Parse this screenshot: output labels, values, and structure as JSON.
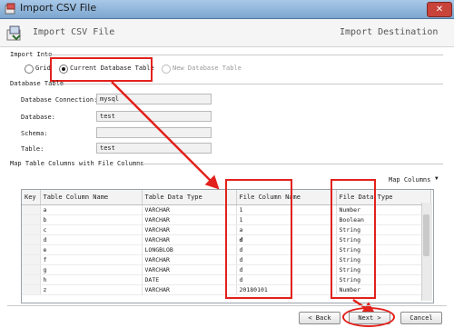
{
  "window": {
    "title": "Import CSV File"
  },
  "header": {
    "title": "Import CSV File",
    "right": "Import Destination"
  },
  "import_into": {
    "label": "Import Into",
    "options": [
      "Grid",
      "Current Database Table",
      "New Database Table"
    ],
    "selected": "Current Database Table"
  },
  "database_table": {
    "label": "Database Table",
    "connection_label": "Database Connection:",
    "connection_value": "mysql",
    "database_label": "Database:",
    "database_value": "test",
    "schema_label": "Schema:",
    "schema_value": "",
    "table_label": "Table:",
    "table_value": "test"
  },
  "mapping": {
    "label": "Map Table Columns with File Columns",
    "map_columns_label": "Map Columns",
    "headers": [
      "Key",
      "Table Column Name",
      "Table Data Type",
      "File Column Name",
      "File Data Type"
    ],
    "rows": [
      [
        "",
        "a",
        "VARCHAR",
        "1",
        "Number"
      ],
      [
        "",
        "b",
        "VARCHAR",
        "1",
        "Boolean"
      ],
      [
        "",
        "c",
        "VARCHAR",
        "a",
        "String"
      ],
      [
        "",
        "d",
        "VARCHAR",
        "d",
        "String"
      ],
      [
        "",
        "e",
        "LONGBLOB",
        "d",
        "String"
      ],
      [
        "",
        "f",
        "VARCHAR",
        "d",
        "String"
      ],
      [
        "",
        "g",
        "VARCHAR",
        "d",
        "String"
      ],
      [
        "",
        "h",
        "DATE",
        "d",
        "String"
      ],
      [
        "",
        "z",
        "VARCHAR",
        "20180101",
        "Number"
      ]
    ]
  },
  "buttons": {
    "back": "< Back",
    "next": "Next >",
    "cancel": "Cancel"
  },
  "colors": {
    "highlight": "#e2211c",
    "titlebar": "#7da6cf"
  }
}
